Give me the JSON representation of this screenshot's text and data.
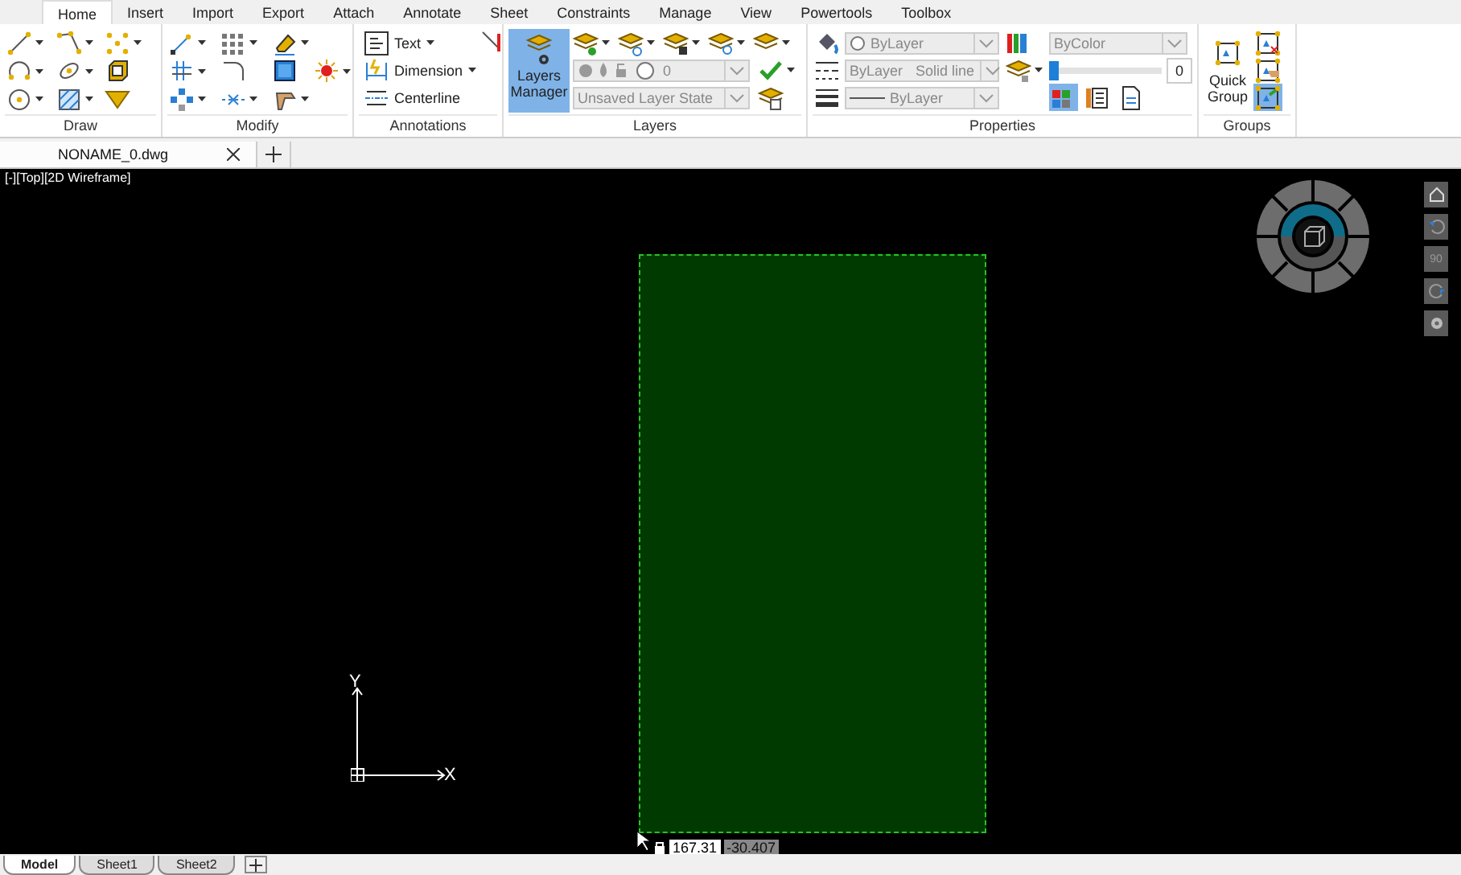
{
  "menu_tabs": [
    {
      "label": "Home",
      "selected": true
    },
    {
      "label": "Insert",
      "selected": false
    },
    {
      "label": "Import",
      "selected": false
    },
    {
      "label": "Export",
      "selected": false
    },
    {
      "label": "Attach",
      "selected": false
    },
    {
      "label": "Annotate",
      "selected": false
    },
    {
      "label": "Sheet",
      "selected": false
    },
    {
      "label": "Constraints",
      "selected": false
    },
    {
      "label": "Manage",
      "selected": false
    },
    {
      "label": "View",
      "selected": false
    },
    {
      "label": "Powertools",
      "selected": false
    },
    {
      "label": "Toolbox",
      "selected": false
    }
  ],
  "ribbon": {
    "draw": {
      "title": "Draw"
    },
    "modify": {
      "title": "Modify"
    },
    "annotations": {
      "title": "Annotations",
      "commands": [
        {
          "label": "Text",
          "menu": true
        },
        {
          "label": "Dimension",
          "menu": true
        },
        {
          "label": "Centerline",
          "menu": false
        }
      ]
    },
    "layers": {
      "title": "Layers",
      "manager": {
        "label": "Layers Manager",
        "selected": true
      },
      "current_layer": {
        "value": "0"
      },
      "layer_state": {
        "value": "Unsaved Layer State"
      }
    },
    "properties": {
      "title": "Properties",
      "color": {
        "value": "ByLayer"
      },
      "linetype": {
        "value": "ByLayer",
        "name": "Solid line"
      },
      "lineweight": {
        "value": "ByLayer"
      },
      "plot_style": {
        "value": "ByColor"
      },
      "transparency": {
        "level": 0,
        "value": "0"
      },
      "toggles": [
        {
          "selected": true
        },
        {
          "selected": false
        },
        {
          "selected": false
        }
      ]
    },
    "groups": {
      "title": "Groups",
      "quick_group": {
        "label": "Quick Group"
      },
      "tools": [
        {
          "selected": false
        },
        {
          "selected": false
        },
        {
          "selected": true
        }
      ]
    }
  },
  "document_tabs": [
    {
      "label": "NONAME_0.dwg",
      "selected": true
    }
  ],
  "viewport": {
    "label": "[-][Top][2D Wireframe]",
    "shapes": [
      {
        "kind": "rectangle",
        "selected": true
      }
    ],
    "axis_labels": {
      "x": "X",
      "y": "Y"
    },
    "coordinates": [
      {
        "value": "167.31",
        "selected": true
      },
      {
        "value": "-30.407",
        "selected": false
      }
    ],
    "view_angle": "90"
  },
  "sheet_tabs": [
    {
      "label": "Model",
      "selected": true
    },
    {
      "label": "Sheet1",
      "selected": false
    },
    {
      "label": "Sheet2",
      "selected": false
    }
  ]
}
